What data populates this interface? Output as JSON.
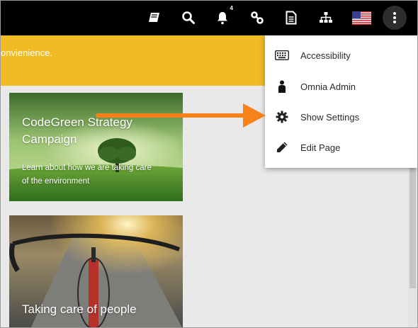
{
  "topbar": {
    "icons": [
      "book-icon",
      "search-icon",
      "bell-icon",
      "link-icon",
      "document-icon",
      "sitemap-icon",
      "us-flag-icon",
      "more-vertical-icon"
    ],
    "notification_count": "4"
  },
  "banner": {
    "text": "onvienience."
  },
  "cards": [
    {
      "title_line1": "CodeGreen Strategy",
      "title_line2": "Campaign",
      "sub_line1": " Learn about how we are taking care",
      "sub_line2": "of the environment"
    },
    {
      "title": "Taking care of people"
    }
  ],
  "menu": {
    "items": [
      {
        "label": "Accessibility",
        "icon": "keyboard-icon"
      },
      {
        "label": "Omnia Admin",
        "icon": "person-icon"
      },
      {
        "label": "Show Settings",
        "icon": "gear-icon"
      },
      {
        "label": "Edit Page",
        "icon": "pencil-icon"
      }
    ]
  },
  "colors": {
    "topbar": "#000000",
    "banner": "#f0bb23",
    "arrow": "#f7821b",
    "content_bg": "#e9e9e9"
  }
}
